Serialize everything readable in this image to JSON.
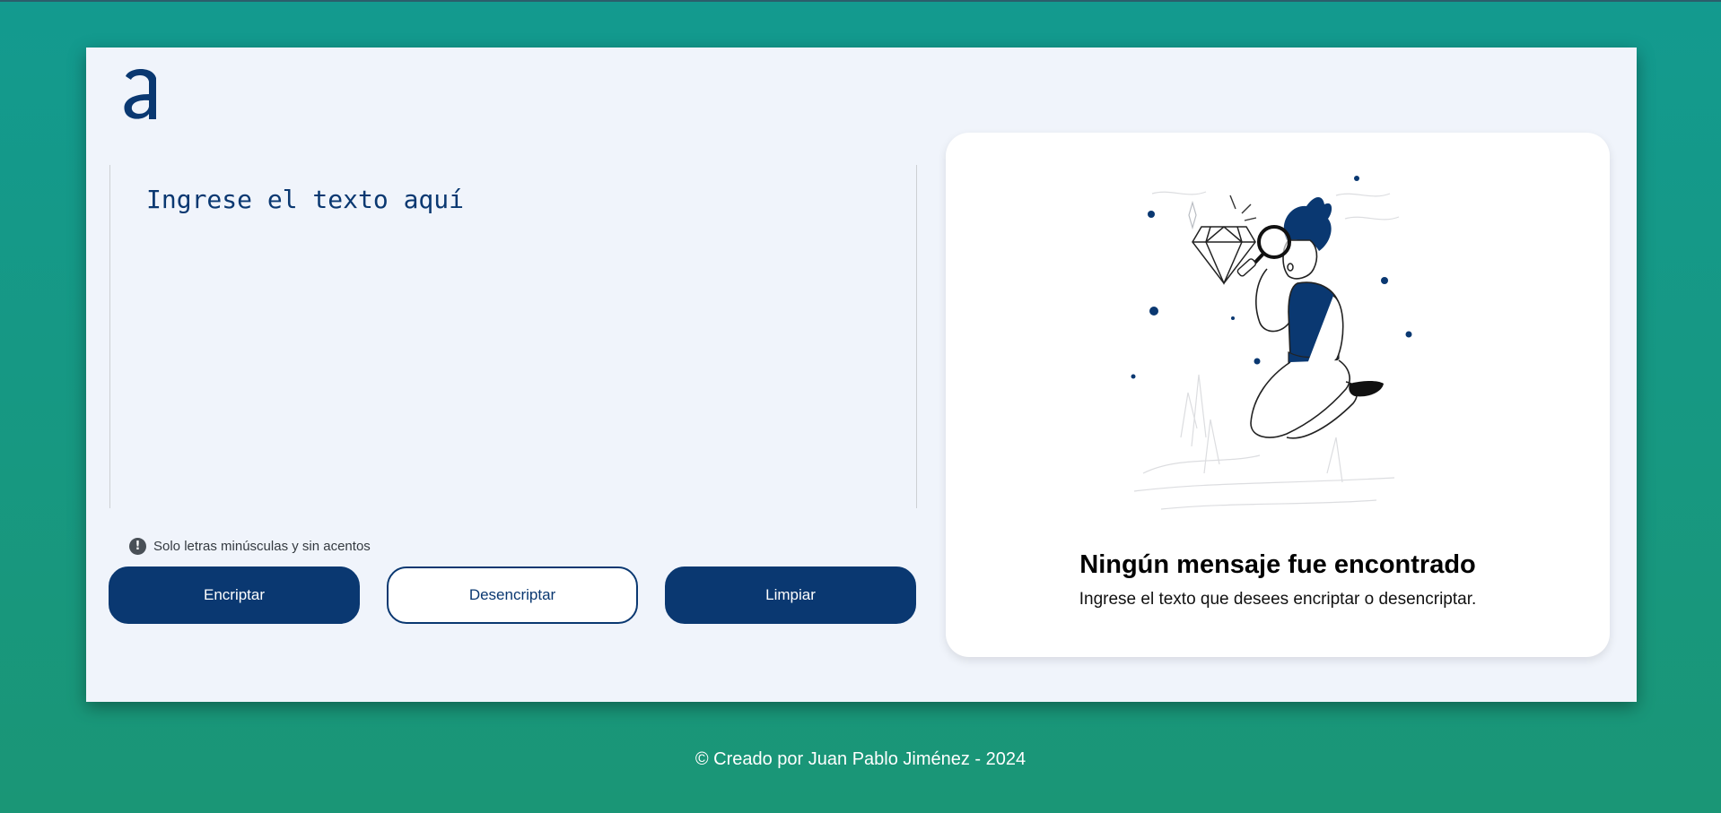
{
  "app": {
    "logo_letter": "a"
  },
  "editor": {
    "placeholder": "Ingrese el texto aquí",
    "value": ""
  },
  "warning": {
    "icon": "exclamation-circle-icon",
    "icon_glyph": "!",
    "text": "Solo letras minúsculas y sin acentos"
  },
  "buttons": {
    "encrypt": "Encriptar",
    "decrypt": "Desencriptar",
    "clear": "Limpiar"
  },
  "result_panel": {
    "illustration": "person-with-magnifying-glass-illustration",
    "title": "Ningún mensaje fue encontrado",
    "subtitle": "Ingrese el texto que desees encriptar o desencriptar."
  },
  "footer": {
    "text": "© Creado por Juan Pablo Jiménez - 2024"
  },
  "colors": {
    "primary": "#0a3871",
    "background_top": "#139a8f",
    "background_bottom": "#1a9676",
    "card": "#f0f4fb"
  }
}
